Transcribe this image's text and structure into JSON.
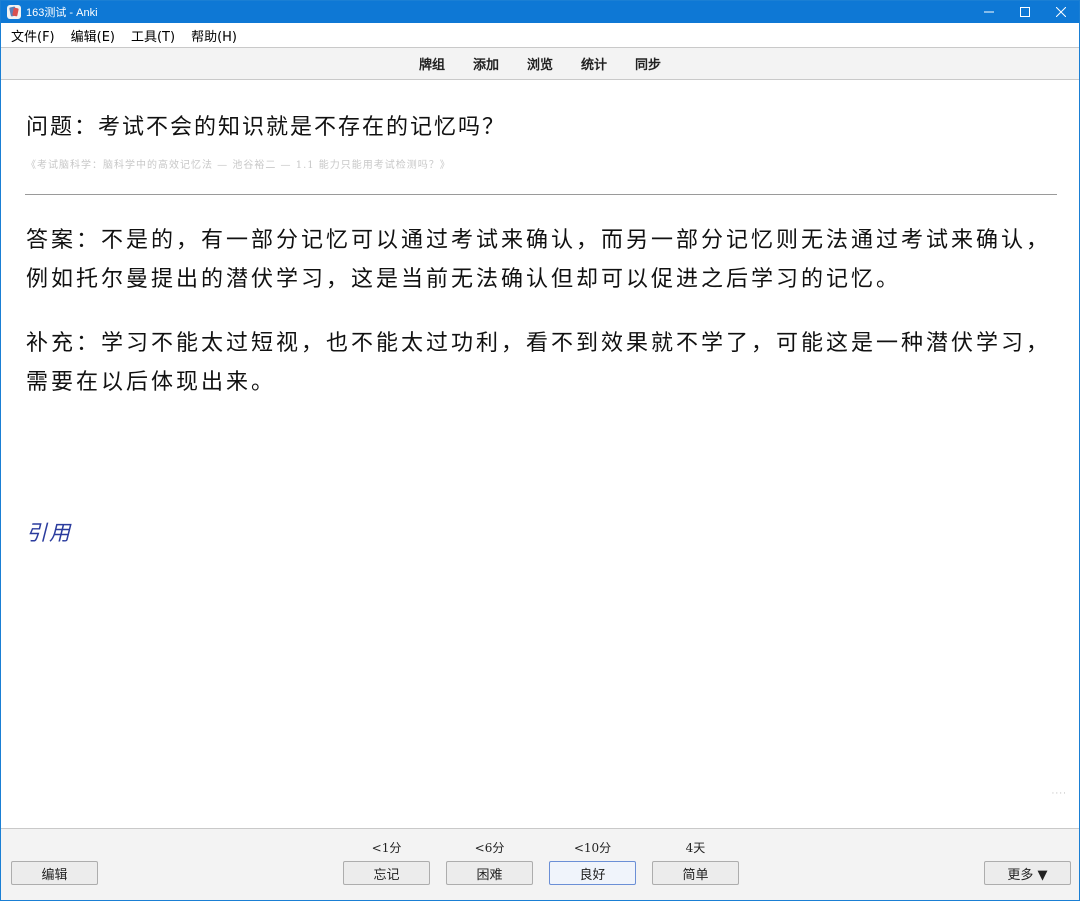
{
  "window": {
    "title": "163测试 - Anki"
  },
  "menu": [
    "文件(F)",
    "编辑(E)",
    "工具(T)",
    "帮助(H)"
  ],
  "toolbar": [
    "牌组",
    "添加",
    "浏览",
    "统计",
    "同步"
  ],
  "card": {
    "question": "问题：考试不会的知识就是不存在的记忆吗？",
    "source": "《考试脑科学：脑科学中的高效记忆法 — 池谷裕二 — 1.1 能力只能用考试检测吗？》",
    "answer": "答案：不是的，有一部分记忆可以通过考试来确认，而另一部分记忆则无法通过考试来确认，例如托尔曼提出的潜伏学习，这是当前无法确认但却可以促进之后学习的记忆。",
    "supplement": "补充：学习不能太过短视，也不能太过功利，看不到效果就不学了，可能这是一种潜伏学习，需要在以后体现出来。",
    "quote_link": "引用"
  },
  "bottom": {
    "edit_label": "编辑",
    "more_label": "更多 ▼",
    "answers": [
      {
        "interval": "<1分",
        "label": "忘记"
      },
      {
        "interval": "<6分",
        "label": "困难"
      },
      {
        "interval": "<10分",
        "label": "良好"
      },
      {
        "interval": "4天",
        "label": "简单"
      }
    ]
  }
}
